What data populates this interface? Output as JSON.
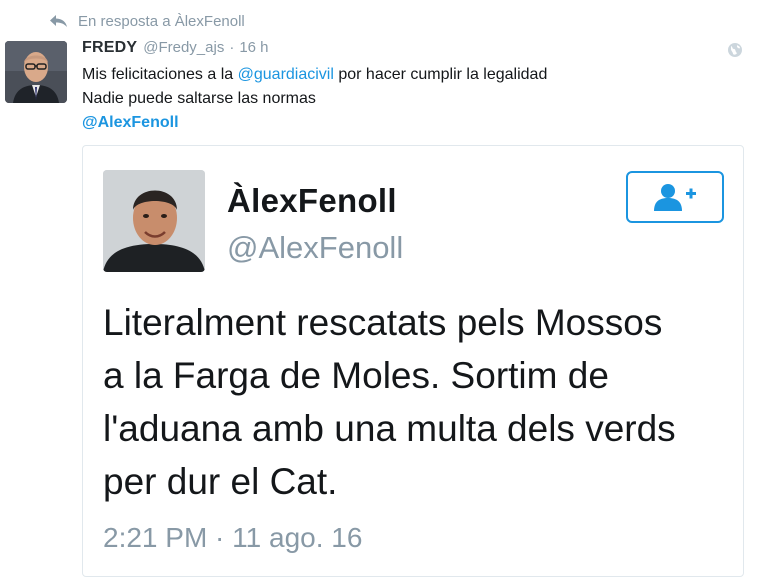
{
  "reply": {
    "label": "En resposta a ÀlexFenoll"
  },
  "tweet": {
    "name": "FREDY",
    "handle": "@Fredy_ajs",
    "separator": "·",
    "time": "16 h",
    "line1_pre": "Mis felicitaciones a la ",
    "line1_mention": "@guardiacivil",
    "line1_post": " por hacer cumplir la legalidad",
    "line2": "Nadie puede saltarse las normas",
    "line3_mention": "@AlexFenoll"
  },
  "embedded": {
    "name": "ÀlexFenoll",
    "handle": "@AlexFenoll",
    "text_lines": [
      "Literalment rescatats pels Mossos",
      "a la Farga de Moles.  Sortim de",
      "l'aduana amb una multa dels verds",
      "per dur el Cat."
    ],
    "date": "2:21 PM · 11 ago. 16"
  },
  "colors": {
    "link": "#1b95e0",
    "muted": "#8899a6",
    "text": "#14171a"
  },
  "icons": {
    "reply": "reply-arrow-icon",
    "globe": "globe-icon",
    "follow": "follow-user-icon"
  }
}
